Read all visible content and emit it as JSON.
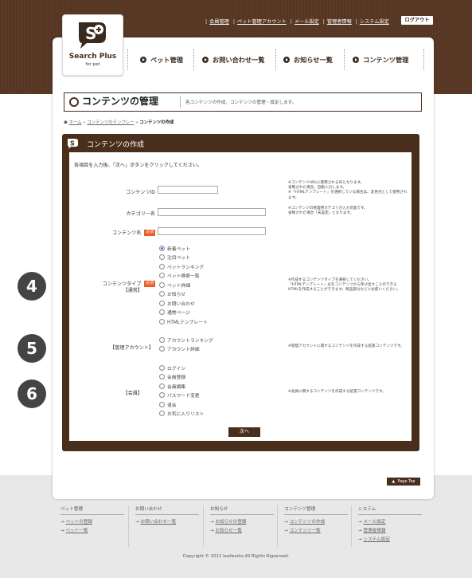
{
  "header": {
    "top_links": [
      "会員管理",
      "ペット管理アカウント",
      "メール設定",
      "管理者情報",
      "システム設定"
    ],
    "logout": "ログアウト",
    "logo": {
      "line1": "Search Plus",
      "line2": "for pet"
    },
    "nav": [
      "ペット管理",
      "お問い合わせ一覧",
      "お知らせ一覧",
      "コンテンツ管理"
    ]
  },
  "title_bar": {
    "title": "コンテンツの管理",
    "description": "各コンテンツの作成、コンテンツの管理・設定します。"
  },
  "breadcrumb": {
    "home": "ホーム",
    "parent": "コンテンツのテンプレー",
    "current": "コンテンツの作成",
    "separator": "»"
  },
  "form": {
    "panel_title": "コンテンツの作成",
    "lead": "各項目を入力後、「次へ」ボタンをクリックしてください。",
    "required_badge": "必須",
    "fields": {
      "content_id": {
        "label": "コンテンツID",
        "value": "",
        "note": [
          "※コンテンツURLに使用されるIDとなります。",
          "省略された場合、自動入力します。",
          "※「HTMLテンプレート」を選択している場合は、変更点として使用されます。"
        ]
      },
      "category": {
        "label": "カテゴリー名",
        "value": "",
        "note": [
          "※コンテンツの管理用カテゴリが入力可能です。",
          "省略された場合「未設定」となります。"
        ]
      },
      "content_name": {
        "label": "コンテンツ名",
        "value": ""
      },
      "content_type": {
        "label": "コンテンツタイプ",
        "sub": "【通常】",
        "options": [
          "新着ペット",
          "注目ペット",
          "ペットランキング",
          "ペット検索一覧",
          "ペット詳細",
          "お知らせ",
          "お問い合わせ",
          "通常ページ",
          "HTMLテンプレート"
        ],
        "selected": "新着ペット",
        "note": [
          "※作成するコンテンツタイプを選択してください。",
          "「HTMLテンプレート」はをコンテンツから呼び出すことのできる",
          "HTMLを作成することができます。製品部分などにお使いください。"
        ]
      },
      "admin_account": {
        "label": "【管理アカウント】",
        "options": [
          "アカウントランキング",
          "アカウント詳細"
        ],
        "note": [
          "※管理アカウントに関するコンテンツを作成する拡張コンテンツです。"
        ]
      },
      "member": {
        "label": "【会員】",
        "options": [
          "ログイン",
          "会員登録",
          "会員編集",
          "パスワード変更",
          "退会",
          "お気に入りリスト"
        ],
        "note": [
          "※会員に関するコンテンツを作成する拡張コンテンツです。"
        ]
      }
    },
    "next_button": "次へ"
  },
  "markers": [
    "4",
    "5",
    "6"
  ],
  "page_top": "Page Top",
  "footer": {
    "columns": [
      {
        "heading": "ペット管理",
        "links": [
          "ペットの登録",
          "ペット一覧"
        ]
      },
      {
        "heading": "お問い合わせ",
        "links": [
          "お問い合わせ一覧"
        ]
      },
      {
        "heading": "お知らせ",
        "links": [
          "お知らせの登録",
          "お知らせ一覧"
        ]
      },
      {
        "heading": "コンテンツ管理",
        "links": [
          "コンテンツの作成",
          "コンテンツ一覧"
        ]
      },
      {
        "heading": "システム",
        "links": [
          "メール設定",
          "管理者情報",
          "システム設定"
        ]
      }
    ],
    "copyright": "Copyright © 2012 leafworks All Rights Rigserved."
  },
  "colors": {
    "brand_brown": "#4a2e1c",
    "header_bg": "#5a3a26",
    "required": "#e8602a",
    "footer_bg": "#e8e8e8"
  }
}
